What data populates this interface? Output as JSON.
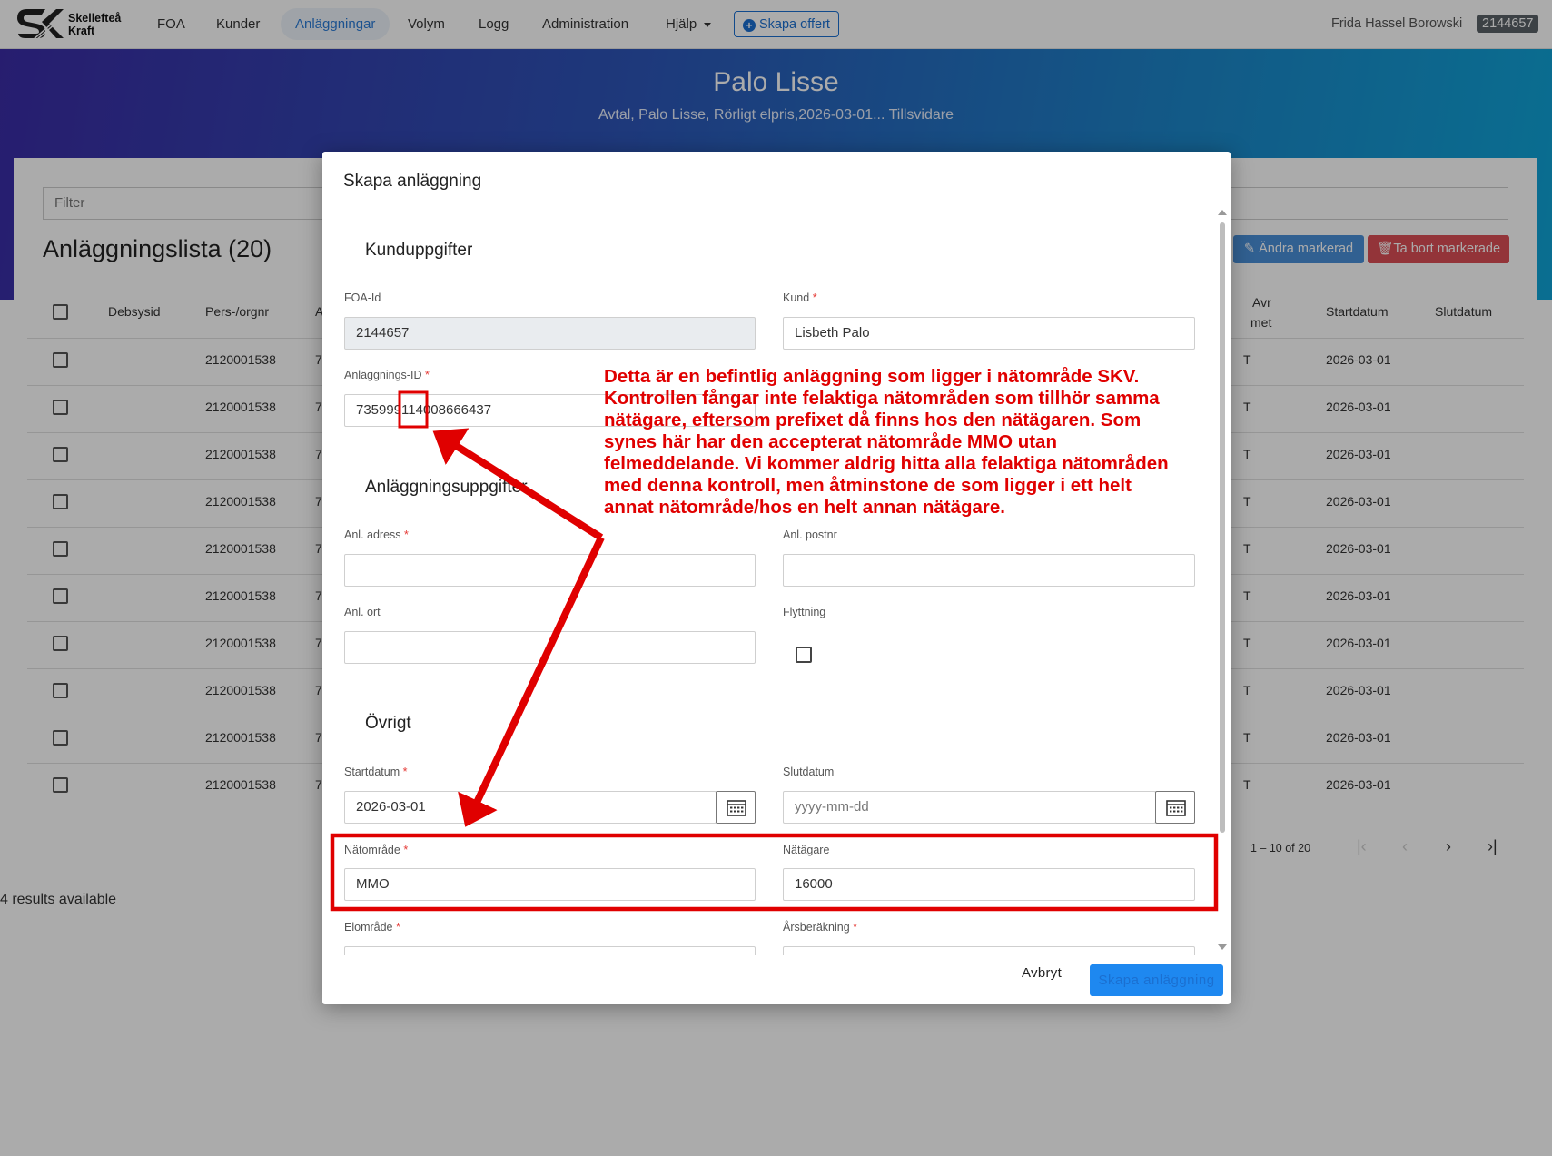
{
  "nav": {
    "logo_line1": "Skellefteå",
    "logo_line2": "Kraft",
    "items": [
      "FOA",
      "Kunder",
      "Anläggningar",
      "Volym",
      "Logg",
      "Administration",
      "Hjälp"
    ],
    "create_offer": "Skapa offert",
    "user_name": "Frida Hassel Borowski",
    "user_id": "2144657"
  },
  "hero": {
    "title": "Palo Lisse",
    "subtitle": "Avtal, Palo Lisse, Rörligt elpris,2026-03-01... Tillsvidare"
  },
  "list": {
    "filter_placeholder": "Filter",
    "title": "Anläggningslista (20)",
    "edit_button": "Ändra markerad",
    "delete_button": "Ta bort markerade",
    "columns": [
      "Debsysid",
      "Pers-/orgnr",
      "A",
      "Avr",
      "met",
      "Startdatum",
      "Slutdatum"
    ],
    "rows": [
      {
        "orgnr": "2120001538",
        "partial": "7",
        "avr": "T",
        "start": "2026-03-01"
      },
      {
        "orgnr": "2120001538",
        "partial": "7",
        "avr": "T",
        "start": "2026-03-01"
      },
      {
        "orgnr": "2120001538",
        "partial": "7",
        "avr": "T",
        "start": "2026-03-01"
      },
      {
        "orgnr": "2120001538",
        "partial": "7",
        "avr": "T",
        "start": "2026-03-01"
      },
      {
        "orgnr": "2120001538",
        "partial": "7",
        "avr": "T",
        "start": "2026-03-01"
      },
      {
        "orgnr": "2120001538",
        "partial": "7",
        "avr": "T",
        "start": "2026-03-01"
      },
      {
        "orgnr": "2120001538",
        "partial": "7",
        "avr": "T",
        "start": "2026-03-01"
      },
      {
        "orgnr": "2120001538",
        "partial": "7",
        "avr": "T",
        "start": "2026-03-01"
      },
      {
        "orgnr": "2120001538",
        "partial": "7",
        "avr": "T",
        "start": "2026-03-01"
      },
      {
        "orgnr": "2120001538",
        "partial": "7",
        "avr": "T",
        "start": "2026-03-01"
      }
    ],
    "pager": "1 – 10 of 20",
    "results": "4 results available"
  },
  "modal": {
    "title": "Skapa anläggning",
    "section_customer": "Kunduppgifter",
    "foa_label": "FOA-Id",
    "foa_value": "2144657",
    "kund_label": "Kund",
    "kund_value": "Lisbeth Palo",
    "anl_id_label": "Anläggnings-ID",
    "anl_id_value": "735999114008666437",
    "section_facility": "Anläggningsuppgifter",
    "adress_label": "Anl. adress",
    "postnr_label": "Anl. postnr",
    "ort_label": "Anl. ort",
    "flytt_label": "Flyttning",
    "section_other": "Övrigt",
    "start_label": "Startdatum",
    "start_value": "2026-03-01",
    "slut_label": "Slutdatum",
    "slut_placeholder": "yyyy-mm-dd",
    "natomrade_label": "Nätområde",
    "natomrade_value": "MMO",
    "natagare_label": "Nätägare",
    "natagare_value": "16000",
    "elomrade_label": "Elområde",
    "arsber_label": "Årsberäkning",
    "cancel": "Avbryt",
    "create": "Skapa anläggning"
  },
  "annotation": {
    "text": "Detta är en befintlig anläggning som ligger i nätområde SKV. Kontrollen fångar inte felaktiga nätområden som tillhör samma nätägare, eftersom prefixet då finns hos den nätägaren. Som synes här har den accepterat nätområde MMO utan felmeddelande. Vi kommer aldrig hitta alla felaktiga nätområden med denna kontroll, men åtminstone de som ligger i ett helt annat nätområde/hos en helt annan nätägare.",
    "color": "#e00000"
  }
}
